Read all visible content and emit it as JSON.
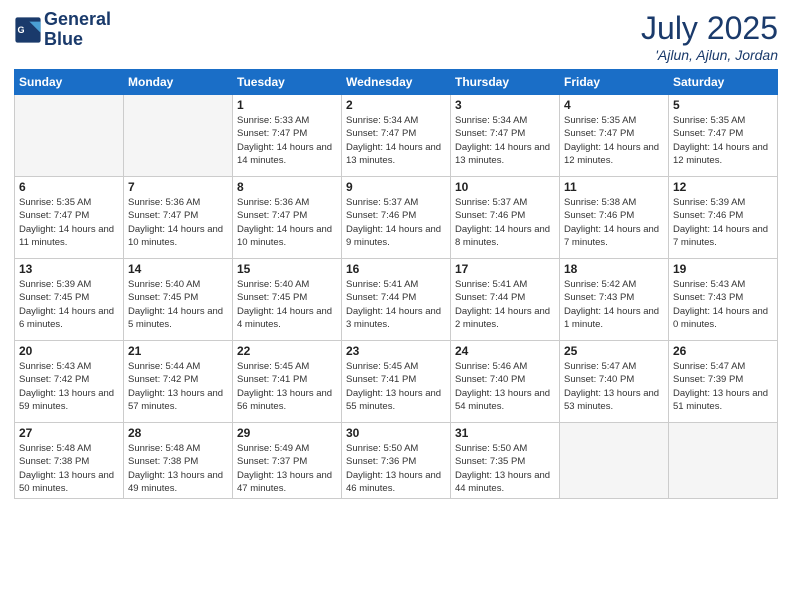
{
  "header": {
    "logo_line1": "General",
    "logo_line2": "Blue",
    "title": "July 2025",
    "subtitle": "'Ajlun, Ajlun, Jordan"
  },
  "days_of_week": [
    "Sunday",
    "Monday",
    "Tuesday",
    "Wednesday",
    "Thursday",
    "Friday",
    "Saturday"
  ],
  "weeks": [
    [
      {
        "day": "",
        "empty": true
      },
      {
        "day": "",
        "empty": true
      },
      {
        "day": "1",
        "sunrise": "Sunrise: 5:33 AM",
        "sunset": "Sunset: 7:47 PM",
        "daylight": "Daylight: 14 hours and 14 minutes."
      },
      {
        "day": "2",
        "sunrise": "Sunrise: 5:34 AM",
        "sunset": "Sunset: 7:47 PM",
        "daylight": "Daylight: 14 hours and 13 minutes."
      },
      {
        "day": "3",
        "sunrise": "Sunrise: 5:34 AM",
        "sunset": "Sunset: 7:47 PM",
        "daylight": "Daylight: 14 hours and 13 minutes."
      },
      {
        "day": "4",
        "sunrise": "Sunrise: 5:35 AM",
        "sunset": "Sunset: 7:47 PM",
        "daylight": "Daylight: 14 hours and 12 minutes."
      },
      {
        "day": "5",
        "sunrise": "Sunrise: 5:35 AM",
        "sunset": "Sunset: 7:47 PM",
        "daylight": "Daylight: 14 hours and 12 minutes."
      }
    ],
    [
      {
        "day": "6",
        "sunrise": "Sunrise: 5:35 AM",
        "sunset": "Sunset: 7:47 PM",
        "daylight": "Daylight: 14 hours and 11 minutes."
      },
      {
        "day": "7",
        "sunrise": "Sunrise: 5:36 AM",
        "sunset": "Sunset: 7:47 PM",
        "daylight": "Daylight: 14 hours and 10 minutes."
      },
      {
        "day": "8",
        "sunrise": "Sunrise: 5:36 AM",
        "sunset": "Sunset: 7:47 PM",
        "daylight": "Daylight: 14 hours and 10 minutes."
      },
      {
        "day": "9",
        "sunrise": "Sunrise: 5:37 AM",
        "sunset": "Sunset: 7:46 PM",
        "daylight": "Daylight: 14 hours and 9 minutes."
      },
      {
        "day": "10",
        "sunrise": "Sunrise: 5:37 AM",
        "sunset": "Sunset: 7:46 PM",
        "daylight": "Daylight: 14 hours and 8 minutes."
      },
      {
        "day": "11",
        "sunrise": "Sunrise: 5:38 AM",
        "sunset": "Sunset: 7:46 PM",
        "daylight": "Daylight: 14 hours and 7 minutes."
      },
      {
        "day": "12",
        "sunrise": "Sunrise: 5:39 AM",
        "sunset": "Sunset: 7:46 PM",
        "daylight": "Daylight: 14 hours and 7 minutes."
      }
    ],
    [
      {
        "day": "13",
        "sunrise": "Sunrise: 5:39 AM",
        "sunset": "Sunset: 7:45 PM",
        "daylight": "Daylight: 14 hours and 6 minutes."
      },
      {
        "day": "14",
        "sunrise": "Sunrise: 5:40 AM",
        "sunset": "Sunset: 7:45 PM",
        "daylight": "Daylight: 14 hours and 5 minutes."
      },
      {
        "day": "15",
        "sunrise": "Sunrise: 5:40 AM",
        "sunset": "Sunset: 7:45 PM",
        "daylight": "Daylight: 14 hours and 4 minutes."
      },
      {
        "day": "16",
        "sunrise": "Sunrise: 5:41 AM",
        "sunset": "Sunset: 7:44 PM",
        "daylight": "Daylight: 14 hours and 3 minutes."
      },
      {
        "day": "17",
        "sunrise": "Sunrise: 5:41 AM",
        "sunset": "Sunset: 7:44 PM",
        "daylight": "Daylight: 14 hours and 2 minutes."
      },
      {
        "day": "18",
        "sunrise": "Sunrise: 5:42 AM",
        "sunset": "Sunset: 7:43 PM",
        "daylight": "Daylight: 14 hours and 1 minute."
      },
      {
        "day": "19",
        "sunrise": "Sunrise: 5:43 AM",
        "sunset": "Sunset: 7:43 PM",
        "daylight": "Daylight: 14 hours and 0 minutes."
      }
    ],
    [
      {
        "day": "20",
        "sunrise": "Sunrise: 5:43 AM",
        "sunset": "Sunset: 7:42 PM",
        "daylight": "Daylight: 13 hours and 59 minutes."
      },
      {
        "day": "21",
        "sunrise": "Sunrise: 5:44 AM",
        "sunset": "Sunset: 7:42 PM",
        "daylight": "Daylight: 13 hours and 57 minutes."
      },
      {
        "day": "22",
        "sunrise": "Sunrise: 5:45 AM",
        "sunset": "Sunset: 7:41 PM",
        "daylight": "Daylight: 13 hours and 56 minutes."
      },
      {
        "day": "23",
        "sunrise": "Sunrise: 5:45 AM",
        "sunset": "Sunset: 7:41 PM",
        "daylight": "Daylight: 13 hours and 55 minutes."
      },
      {
        "day": "24",
        "sunrise": "Sunrise: 5:46 AM",
        "sunset": "Sunset: 7:40 PM",
        "daylight": "Daylight: 13 hours and 54 minutes."
      },
      {
        "day": "25",
        "sunrise": "Sunrise: 5:47 AM",
        "sunset": "Sunset: 7:40 PM",
        "daylight": "Daylight: 13 hours and 53 minutes."
      },
      {
        "day": "26",
        "sunrise": "Sunrise: 5:47 AM",
        "sunset": "Sunset: 7:39 PM",
        "daylight": "Daylight: 13 hours and 51 minutes."
      }
    ],
    [
      {
        "day": "27",
        "sunrise": "Sunrise: 5:48 AM",
        "sunset": "Sunset: 7:38 PM",
        "daylight": "Daylight: 13 hours and 50 minutes."
      },
      {
        "day": "28",
        "sunrise": "Sunrise: 5:48 AM",
        "sunset": "Sunset: 7:38 PM",
        "daylight": "Daylight: 13 hours and 49 minutes."
      },
      {
        "day": "29",
        "sunrise": "Sunrise: 5:49 AM",
        "sunset": "Sunset: 7:37 PM",
        "daylight": "Daylight: 13 hours and 47 minutes."
      },
      {
        "day": "30",
        "sunrise": "Sunrise: 5:50 AM",
        "sunset": "Sunset: 7:36 PM",
        "daylight": "Daylight: 13 hours and 46 minutes."
      },
      {
        "day": "31",
        "sunrise": "Sunrise: 5:50 AM",
        "sunset": "Sunset: 7:35 PM",
        "daylight": "Daylight: 13 hours and 44 minutes."
      },
      {
        "day": "",
        "empty": true
      },
      {
        "day": "",
        "empty": true
      }
    ]
  ]
}
